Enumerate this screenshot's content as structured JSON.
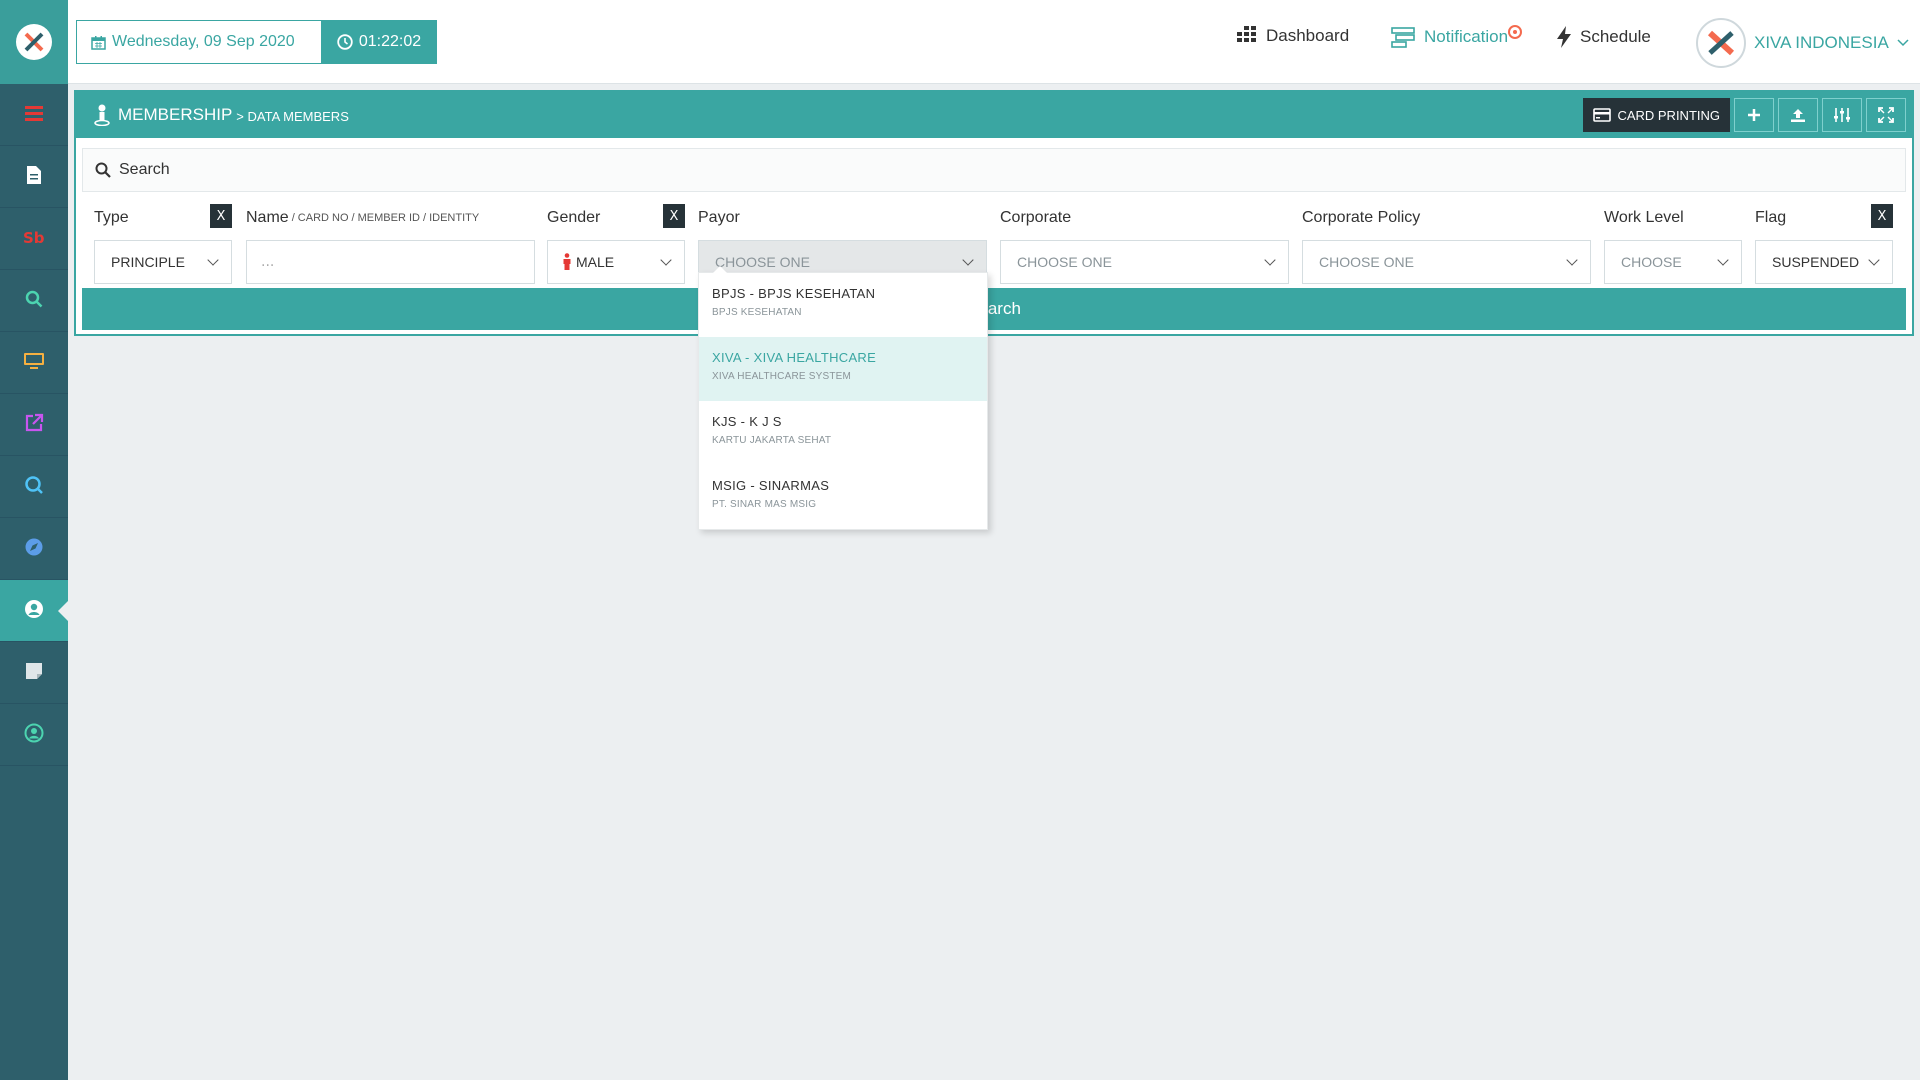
{
  "header": {
    "date": "Wednesday, 09 Sep 2020",
    "time": "01:22:02",
    "nav": {
      "dashboard": "Dashboard",
      "notification": "Notification",
      "schedule": "Schedule"
    },
    "org_name": "XIVA INDONESIA"
  },
  "sidebar": {
    "items": [
      {
        "icon": "menu-icon",
        "color": "#e53935"
      },
      {
        "icon": "document-icon",
        "color": "#ffffff"
      },
      {
        "icon": "sb-icon",
        "color": "#e53935"
      },
      {
        "icon": "search-icon",
        "color": "#4cd4b0"
      },
      {
        "icon": "monitor-icon",
        "color": "#f5b041"
      },
      {
        "icon": "external-link-icon",
        "color": "#c855f0"
      },
      {
        "icon": "refresh-search-icon",
        "color": "#4fc3f7"
      },
      {
        "icon": "compass-icon",
        "color": "#5c9de8"
      },
      {
        "icon": "user-icon",
        "color": "#ffffff",
        "active": true
      },
      {
        "icon": "note-icon",
        "color": "#dfe6e9"
      },
      {
        "icon": "account-icon",
        "color": "#4cd4b0"
      }
    ]
  },
  "panel": {
    "title": "MEMBERSHIP",
    "subtitle": "> DATA MEMBERS",
    "card_printing": "CARD PRINTING",
    "search_label": "Search",
    "search_button": "Search",
    "clear_label": "X"
  },
  "filters": {
    "type": {
      "label": "Type",
      "value": "PRINCIPLE"
    },
    "name": {
      "label": "Name",
      "hint_1": "/ CARD NO",
      "hint_2": "/ MEMBER ID",
      "hint_3": "/ IDENTITY",
      "placeholder": "..."
    },
    "gender": {
      "label": "Gender",
      "value": "MALE"
    },
    "payor": {
      "label": "Payor",
      "value": "CHOOSE ONE"
    },
    "corporate": {
      "label": "Corporate",
      "value": "CHOOSE ONE"
    },
    "corporate_policy": {
      "label": "Corporate Policy",
      "value": "CHOOSE ONE"
    },
    "work_level": {
      "label": "Work Level",
      "value": "CHOOSE"
    },
    "flag": {
      "label": "Flag",
      "value": "SUSPENDED"
    }
  },
  "payor_options": [
    {
      "main": "BPJS - BPJS KESEHATAN",
      "sub": "BPJS KESEHATAN",
      "highlighted": false
    },
    {
      "main": "XIVA - XIVA HEALTHCARE",
      "sub": "XIVA HEALTHCARE SYSTEM",
      "highlighted": true
    },
    {
      "main": "KJS - K J S",
      "sub": "KARTU JAKARTA SEHAT",
      "highlighted": false
    },
    {
      "main": "MSIG - SINARMAS",
      "sub": "PT. SINAR MAS MSIG",
      "highlighted": false
    }
  ],
  "colors": {
    "accent": "#3aa6a2",
    "sidebar": "#2e5f6b",
    "dark": "#263238",
    "notification": "#f46a4e"
  }
}
